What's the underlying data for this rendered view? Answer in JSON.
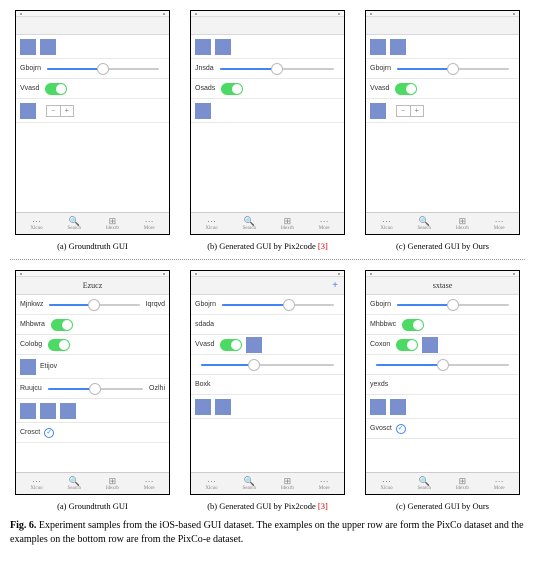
{
  "figure_label": "Fig. 6.",
  "caption_text": "Experiment samples from the iOS-based GUI dataset. The examples on the upper row are form the PixCo dataset and the examples on the bottom row are from the PixCo-e dataset.",
  "citation_ref": "[3]",
  "subcaptions": {
    "a": "(a) Groundtruth GUI",
    "b_prefix": "(b) Generated GUI by Pix2code ",
    "c": "(c) Generated GUI by Ours"
  },
  "tabbar": {
    "items": [
      "Xlcuo",
      "Search",
      "Idexrb",
      "More"
    ]
  },
  "phones": {
    "r1a": {
      "rows": [
        {
          "type": "squares",
          "count": 2
        },
        {
          "type": "label-slider",
          "label": "Gbojrn",
          "fill": 50
        },
        {
          "type": "label-toggle",
          "label": "Vvasd"
        },
        {
          "type": "square-stepper"
        }
      ]
    },
    "r1b": {
      "rows": [
        {
          "type": "squares",
          "count": 2
        },
        {
          "type": "label-slider",
          "label": "Jnsda",
          "fill": 50
        },
        {
          "type": "label-toggle",
          "label": "Osads"
        },
        {
          "type": "squares",
          "count": 1
        }
      ]
    },
    "r1c": {
      "rows": [
        {
          "type": "squares",
          "count": 2
        },
        {
          "type": "label-slider",
          "label": "Gbojrn",
          "fill": 50
        },
        {
          "type": "label-toggle",
          "label": "Vvasd"
        },
        {
          "type": "square-stepper"
        }
      ]
    },
    "r2a": {
      "nav_title": "Ezucz",
      "rows": [
        {
          "type": "label-slider-label",
          "left": "Mjnkwz",
          "right": "Iqrqvd",
          "fill": 50
        },
        {
          "type": "label-toggle",
          "label": "Mhbwra"
        },
        {
          "type": "label-toggle",
          "label": "Colobg"
        },
        {
          "type": "square-label",
          "label": "Etijov"
        },
        {
          "type": "label-slider-label",
          "left": "Ruujcu",
          "right": "Ozlhi",
          "fill": 50
        },
        {
          "type": "squares",
          "count": 3
        },
        {
          "type": "label-radio",
          "label": "Crosct"
        }
      ]
    },
    "r2b": {
      "nav_add": "+",
      "rows": [
        {
          "type": "label-slider",
          "label": "Gbojrn",
          "fill": 60
        },
        {
          "type": "label-only",
          "label": "sdada"
        },
        {
          "type": "label-toggle-square",
          "label": "Vvasd"
        },
        {
          "type": "slider-only",
          "fill": 40
        },
        {
          "type": "label-only",
          "label": "Boxk"
        },
        {
          "type": "squares",
          "count": 2
        }
      ]
    },
    "r2c": {
      "nav_title": "sxtase",
      "rows": [
        {
          "type": "label-slider",
          "label": "Gbojrn",
          "fill": 50
        },
        {
          "type": "label-toggle",
          "label": "Mhbbwc"
        },
        {
          "type": "label-toggle-square",
          "label": "Coxon"
        },
        {
          "type": "slider-only",
          "fill": 50
        },
        {
          "type": "label-only",
          "label": "yexds"
        },
        {
          "type": "squares",
          "count": 2
        },
        {
          "type": "label-radio",
          "label": "Gvosct"
        }
      ]
    }
  }
}
